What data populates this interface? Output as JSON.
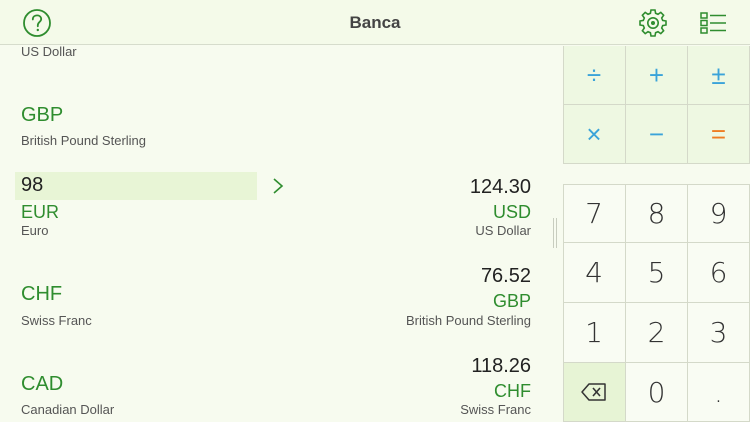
{
  "navbar": {
    "title": "Banca"
  },
  "rows": {
    "row0": {
      "name": "US Dollar"
    },
    "row1": {
      "code": "GBP",
      "name": "British Pound Sterling"
    },
    "row2": {
      "input": "98",
      "code": "EUR",
      "name": "Euro",
      "result": "124.30",
      "result_code": "USD",
      "result_name": "US Dollar"
    },
    "row3": {
      "code": "CHF",
      "name": "Swiss Franc",
      "result": "76.52",
      "result_code": "GBP",
      "result_name": "British Pound Sterling"
    },
    "row4": {
      "code": "CAD",
      "name": "Canadian Dollar",
      "result": "118.26",
      "result_code": "CHF",
      "result_name": "Swiss Franc"
    }
  },
  "operators": {
    "divide": "÷",
    "plus": "+",
    "plus_minus": "±",
    "multiply": "×",
    "minus": "−",
    "equals": "="
  },
  "keypad": {
    "k7": "7",
    "k8": "8",
    "k9": "9",
    "k4": "4",
    "k5": "5",
    "k6": "6",
    "k1": "1",
    "k2": "2",
    "k3": "3",
    "k0": "0",
    "kdot": "."
  },
  "colors": {
    "accent_green": "#2f8d2f",
    "operator_blue": "#3aa3d9",
    "equals_orange": "#ef7d22",
    "background": "#f7fbef"
  },
  "icons": {
    "help": "question-circle-icon",
    "settings": "gear-icon",
    "list": "list-icon",
    "chevron": "chevron-right-icon",
    "backspace": "backspace-icon"
  }
}
